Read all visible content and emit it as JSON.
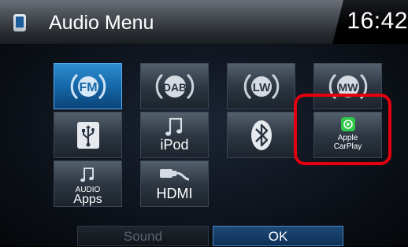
{
  "header": {
    "title": "Audio Menu",
    "clock": "16:42"
  },
  "tiles": {
    "fm": "FM",
    "dab": "DAB",
    "lw": "LW",
    "mw": "MW",
    "usb": "usb-icon",
    "ipod": "iPod",
    "bluetooth": "bluetooth-icon",
    "carplay": {
      "line1": "Apple",
      "line2": "CarPlay"
    },
    "audio_apps": {
      "line1": "AUDIO",
      "line2": "Apps"
    },
    "hdmi": "HDMI"
  },
  "buttons": {
    "sound": "Sound",
    "ok": "OK"
  },
  "colors": {
    "selected_tile": "#1567a8",
    "highlight": "#e3000f",
    "carplay_green": "#2ec84a"
  }
}
